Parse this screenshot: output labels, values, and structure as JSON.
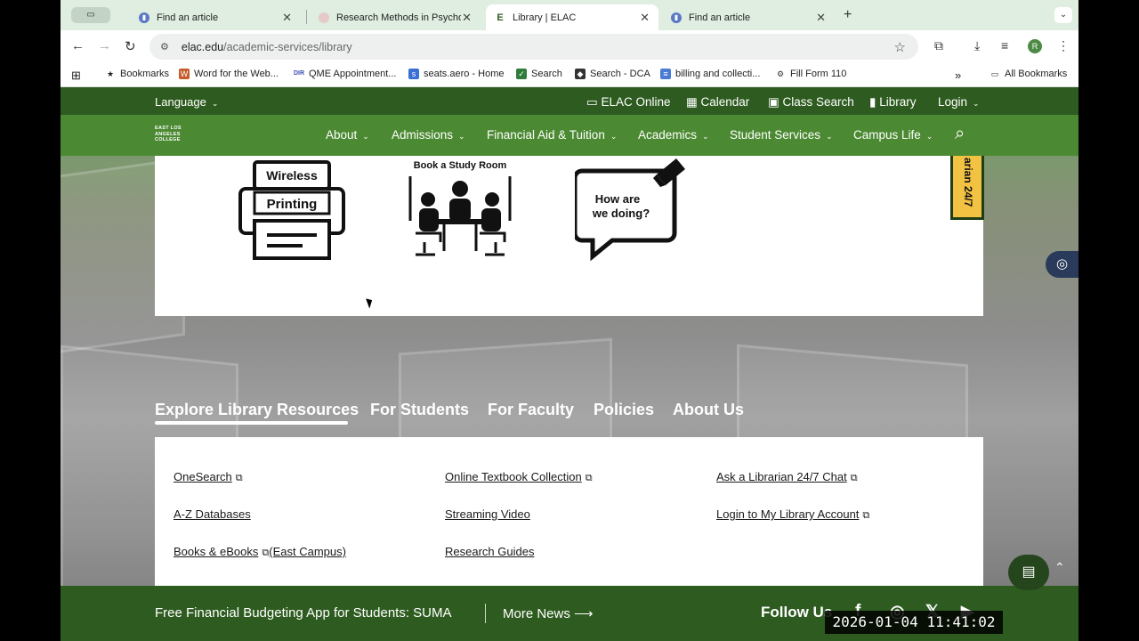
{
  "browser": {
    "tabs": [
      {
        "title": "Find an article",
        "favicon": "document-icon",
        "active": false
      },
      {
        "title": "Research Methods in Psychology",
        "favicon": "book-icon",
        "active": false
      },
      {
        "title": "Library | ELAC",
        "favicon": "E",
        "active": true
      },
      {
        "title": "Find an article",
        "favicon": "document-icon",
        "active": false
      }
    ],
    "new_tab": "+",
    "url_domain": "elac.edu",
    "url_path": "/academic-services/library",
    "avatar_letter": "R",
    "bookmarks": [
      {
        "label": "Bookmarks",
        "icon": "star-icon"
      },
      {
        "label": "Word for the Web...",
        "icon": "word-icon"
      },
      {
        "label": "QME Appointment...",
        "icon": "dir-icon",
        "icon_text": "DIR"
      },
      {
        "label": "seats.aero - Home",
        "icon": "seats-icon"
      },
      {
        "label": "Search",
        "icon": "check-icon"
      },
      {
        "label": "Search - DCA",
        "icon": "shield-icon"
      },
      {
        "label": "billing and collecti...",
        "icon": "doc-icon"
      },
      {
        "label": "Fill Form 110",
        "icon": "gear-icon"
      }
    ],
    "all_bookmarks": "All Bookmarks",
    "overflow": "»"
  },
  "site": {
    "language": "Language",
    "util_links": [
      {
        "label": "ELAC Online",
        "icon": "monitor-icon"
      },
      {
        "label": "Calendar",
        "icon": "calendar-icon"
      },
      {
        "label": "Class Search",
        "icon": "search-box-icon"
      },
      {
        "label": "Library",
        "icon": "book-icon"
      },
      {
        "label": "Login",
        "icon": "chevron-down-icon"
      }
    ],
    "logo_text": [
      "EAST LOS",
      "ANGELES",
      "COLLEGE"
    ],
    "nav": [
      "About",
      "Admissions",
      "Financial Aid & Tuition",
      "Academics",
      "Student Services",
      "Campus Life"
    ],
    "tiles": [
      {
        "line1": "Wireless",
        "line2": "Printing"
      },
      {
        "title": "Book a Study Room"
      },
      {
        "line1": "How are",
        "line2": "we doing?"
      }
    ],
    "side_chat": "arian 24/7",
    "resource_tabs": [
      "Explore Library Resources",
      "For Students",
      "For Faculty",
      "Policies",
      "About Us"
    ],
    "resource_columns": [
      [
        {
          "label": "OneSearch",
          "external": true
        },
        {
          "label": "A-Z Databases",
          "external": false
        },
        {
          "label": "Books & eBooks",
          "external": true,
          "note": "(East Campus)"
        }
      ],
      [
        {
          "label": "Online Textbook Collection",
          "external": true
        },
        {
          "label": "Streaming Video",
          "external": false
        },
        {
          "label": "Research Guides",
          "external": false
        }
      ],
      [
        {
          "label": "Ask a Librarian 24/7 Chat",
          "external": true
        },
        {
          "label": "Login to My Library Account",
          "external": true
        }
      ]
    ],
    "footer": {
      "news": "Free Financial Budgeting App for Students: SUMA",
      "more_news": "More News",
      "follow_us": "Follow Us",
      "social": [
        "facebook-icon",
        "instagram-icon",
        "x-icon",
        "youtube-icon"
      ]
    }
  },
  "overlay_timestamp": "2026-01-04  11:41:02"
}
